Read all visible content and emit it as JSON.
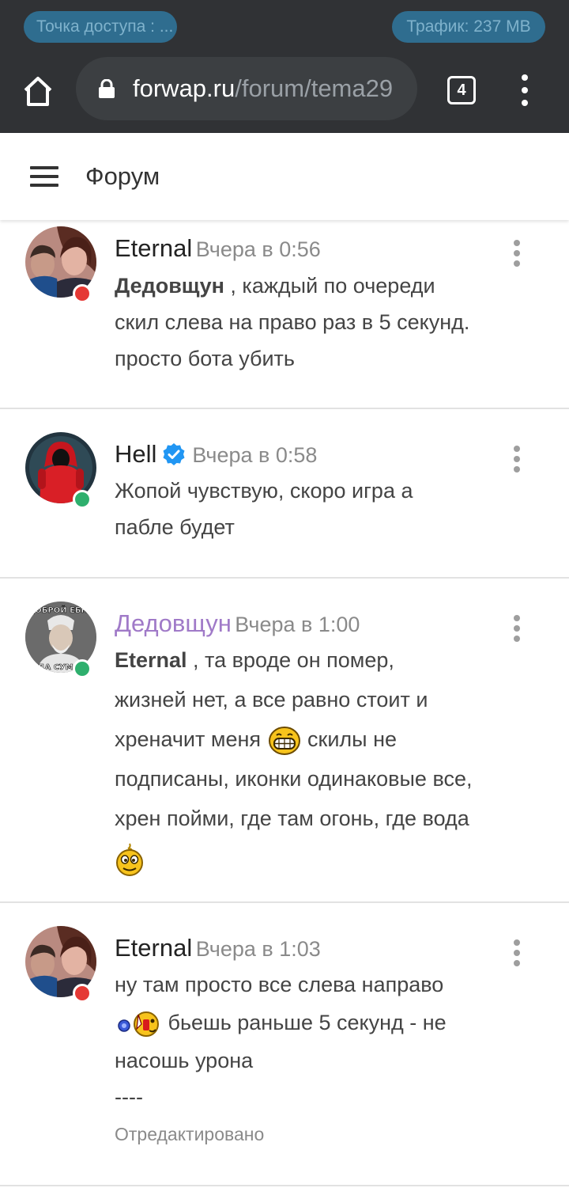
{
  "status_bar": {
    "hotspot_label": "Точка доступа : ...",
    "traffic_label": "Трафик: 237 MB"
  },
  "browser": {
    "url_domain": "forwap.ru",
    "url_path": "/forum/tema29",
    "tab_count": "4"
  },
  "header": {
    "title": "Форум"
  },
  "posts": [
    {
      "author": "Eternal",
      "time": "Вчера в 0:56",
      "status": "offline",
      "mention": "Дедовщун",
      "lines": [
        " , каждый по очереди",
        "скил слева на право раз в 5 секунд.",
        "просто бота убить"
      ]
    },
    {
      "author": "Hell",
      "verified": true,
      "time": "Вчера в 0:58",
      "status": "online",
      "lines": [
        "Жопой чувствую, скоро игра а",
        "пабле будет"
      ]
    },
    {
      "author": "Дедовщун",
      "author_color": "#a07ac8",
      "time": "Вчера в 1:00",
      "status": "online",
      "avatar_caption_top": "ДОБРОЙ ЕБНУ",
      "avatar_caption_bottom": "ДА СУМА",
      "mention": "Eternal",
      "lines": [
        " , та вроде он помер,",
        "жизней нет, а все равно стоит и",
        "хреначит меня",
        " скилы не",
        "подписаны, иконки одинаковые все,",
        "хрен пойми, где там огонь, где вода"
      ],
      "emojis": [
        "grin-emoji",
        "dizzy-emoji"
      ]
    },
    {
      "author": "Eternal",
      "time": "Вчера в 1:03",
      "status": "offline",
      "lines": [
        "ну там просто все слева направо",
        " бьешь раньше 5 секунд - не",
        "насошь урона",
        "----"
      ],
      "edited": "Отредактировано",
      "emojis": [
        "punch-emoji"
      ]
    }
  ],
  "colors": {
    "toolbar_bg": "#303235",
    "pill_bg": "#2f6d8f",
    "online": "#2eaf6d",
    "offline": "#e53935",
    "verified": "#2196f3"
  }
}
